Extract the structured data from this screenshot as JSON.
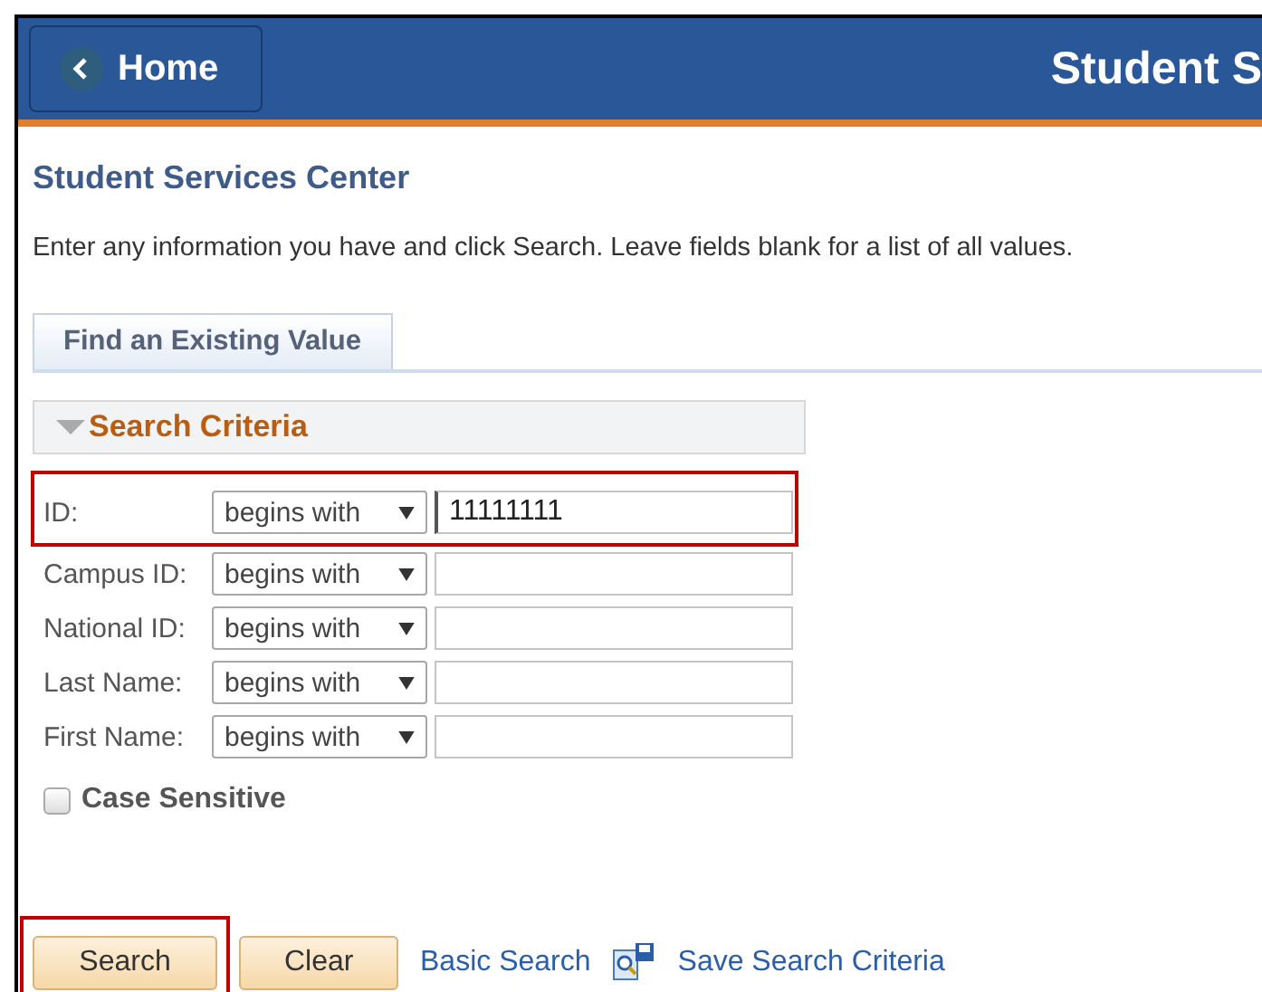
{
  "header": {
    "home_button": "Home",
    "title": "Student S"
  },
  "page_title": "Student Services Center",
  "instructions": "Enter any information you have and click Search. Leave fields blank for a list of all values.",
  "tabs": [
    {
      "label": "Find an Existing Value",
      "selected": true
    }
  ],
  "section": {
    "title": "Search Criteria",
    "expanded": true
  },
  "fields": [
    {
      "label": "ID:",
      "operator": "begins with",
      "value": "11111111",
      "highlighted": true
    },
    {
      "label": "Campus ID:",
      "operator": "begins with",
      "highlighted": false
    },
    {
      "label": "National ID:",
      "operator": "begins with",
      "highlighted": false
    },
    {
      "label": "Last Name:",
      "operator": "begins with",
      "highlighted": false
    },
    {
      "label": "First Name:",
      "operator": "begins with",
      "highlighted": false
    }
  ],
  "case_sensitive": {
    "label": "Case Sensitive",
    "checked": false
  },
  "actions": [
    {
      "kind": "button",
      "label": "Search",
      "highlighted": true
    },
    {
      "kind": "button",
      "label": "Clear",
      "highlighted": false
    },
    {
      "kind": "link",
      "label": "Basic Search"
    },
    {
      "kind": "icon-link",
      "label": "Save Search Criteria"
    }
  ]
}
